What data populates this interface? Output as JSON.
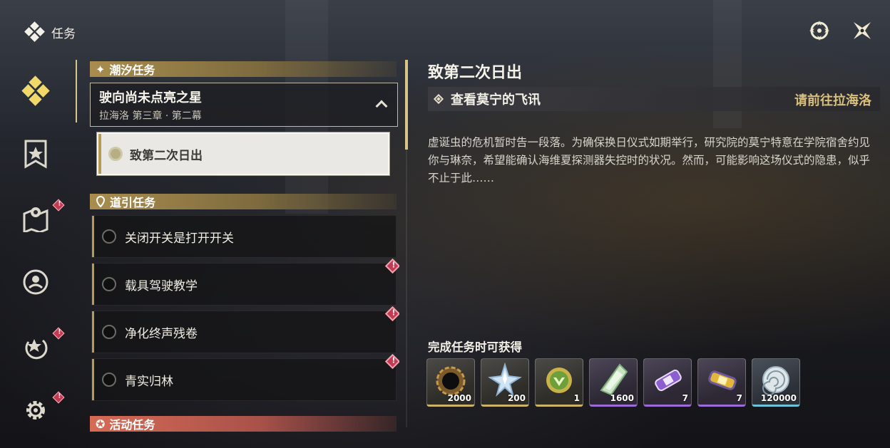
{
  "header": {
    "title": "任务"
  },
  "sections": {
    "tide": "潮汐任务",
    "guide": "道引任务",
    "event": "活动任务"
  },
  "story": {
    "title": "驶向尚未点亮之星",
    "subtitle": "拉海洛 第三章 · 第二幕",
    "selected_subquest": "致第二次日出"
  },
  "guide_quests": [
    {
      "label": "关闭开关是打开开关",
      "alert": false
    },
    {
      "label": "载具驾驶教学",
      "alert": true
    },
    {
      "label": "净化终声残卷",
      "alert": true
    },
    {
      "label": "青实归林",
      "alert": true
    }
  ],
  "detail": {
    "title": "致第二次日出",
    "objective": "查看莫宁的飞讯",
    "objective_action": "请前往拉海洛",
    "description": "虚诞虫的危机暂时告一段落。为确保换日仪式如期举行，研究院的莫宁特意在学院宿舍约见你与琳奈，希望能确认海维夏探测器失控时的状况。然而，可能影响这场仪式的隐患，似乎不止于此……",
    "rewards_title": "完成任务时可获得",
    "rewards": [
      {
        "count": "2000",
        "icon": "dark-gear-icon",
        "rarity": "gold"
      },
      {
        "count": "200",
        "icon": "crystal-star-icon",
        "rarity": "gold"
      },
      {
        "count": "1",
        "icon": "green-emblem-icon",
        "rarity": "gold"
      },
      {
        "count": "1600",
        "icon": "green-crystal-icon",
        "rarity": "purple"
      },
      {
        "count": "7",
        "icon": "purple-canister-icon",
        "rarity": "purple"
      },
      {
        "count": "7",
        "icon": "gold-canister-icon",
        "rarity": "purple"
      },
      {
        "count": "120000",
        "icon": "shell-coin-icon",
        "rarity": "blue"
      }
    ]
  },
  "colors": {
    "accent_gold": "#d9c48a",
    "alert_red": "#c23b52",
    "event_red": "#d66a55"
  }
}
